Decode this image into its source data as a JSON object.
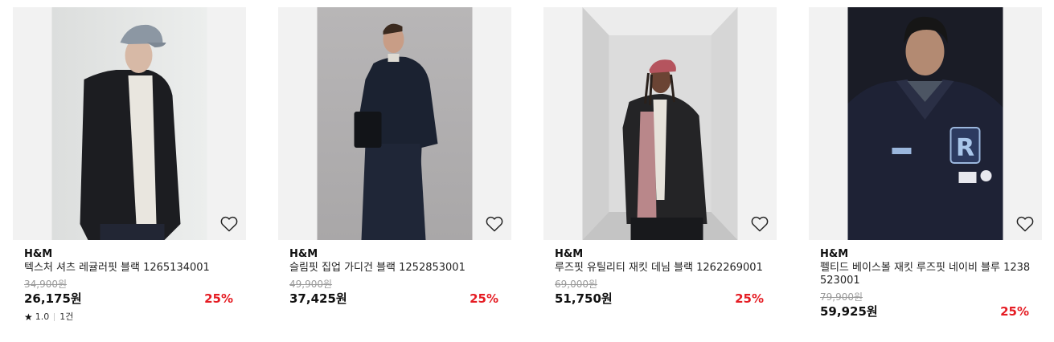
{
  "products": [
    {
      "brand": "H&M",
      "name": "텍스처 셔츠 레귤러핏 블랙 1265134001",
      "original_price": "34,900원",
      "price": "26,175원",
      "discount": "25%",
      "rating": "1.0",
      "review_count": "1건",
      "wishlist_icon": "heart-outline-icon"
    },
    {
      "brand": "H&M",
      "name": "슬림핏 집업 가디건 블랙 1252853001",
      "original_price": "49,900원",
      "price": "37,425원",
      "discount": "25%",
      "wishlist_icon": "heart-outline-icon"
    },
    {
      "brand": "H&M",
      "name": "루즈핏 유틸리티 재킷 데님 블랙 1262269001",
      "original_price": "69,000원",
      "price": "51,750원",
      "discount": "25%",
      "wishlist_icon": "heart-outline-icon"
    },
    {
      "brand": "H&M",
      "name": "펠티드 베이스볼 재킷 루즈핏 네이비 블루 1238523001",
      "original_price": "79,900원",
      "price": "59,925원",
      "discount": "25%",
      "wishlist_icon": "heart-outline-icon"
    }
  ],
  "colors": {
    "discount": "#e51c23",
    "original_price": "#9a9a9a",
    "image_background": "#f2f2f2"
  }
}
